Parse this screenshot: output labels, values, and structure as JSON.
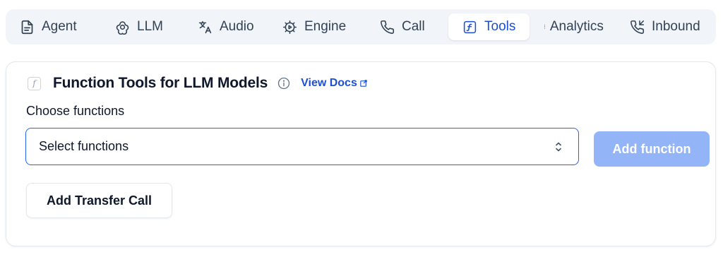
{
  "tabs": [
    {
      "label": "Agent",
      "icon": "document-icon"
    },
    {
      "label": "LLM",
      "icon": "openai-icon"
    },
    {
      "label": "Audio",
      "icon": "translate-icon"
    },
    {
      "label": "Engine",
      "icon": "engine-icon"
    },
    {
      "label": "Call",
      "icon": "phone-icon"
    },
    {
      "label": "Tools",
      "icon": "function-icon",
      "active": true
    },
    {
      "label": "Analytics",
      "icon": "analytics-icon"
    },
    {
      "label": "Inbound",
      "icon": "phone-incoming-icon"
    }
  ],
  "card": {
    "title": "Function Tools for LLM Models",
    "fx_glyph": "f",
    "view_docs": "View Docs",
    "choose_label": "Choose functions",
    "select_placeholder": "Select functions",
    "add_function": "Add function",
    "add_transfer": "Add Transfer Call"
  },
  "colors": {
    "accent": "#1d4ed8",
    "select_border": "#2563eb",
    "disabled_button": "#93b4f7",
    "tabbar_bg": "#f1f5f9"
  }
}
